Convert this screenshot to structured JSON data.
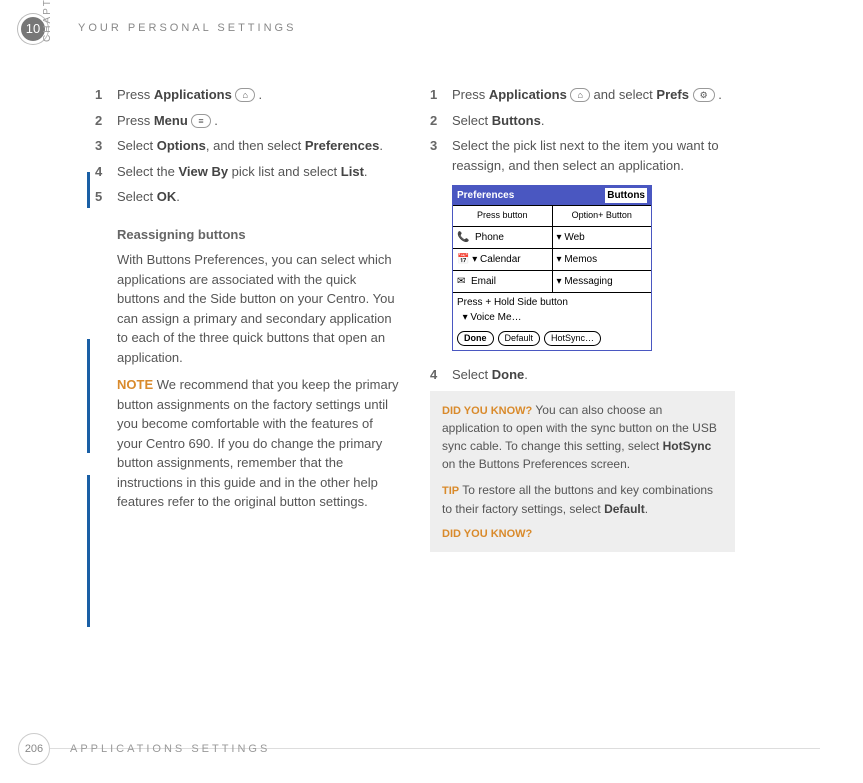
{
  "header": {
    "chapter_number": "10",
    "chapter_label": "CHAPTER",
    "title": "YOUR PERSONAL SETTINGS"
  },
  "footer": {
    "page_number": "206",
    "section": "APPLICATIONS SETTINGS"
  },
  "icons": {
    "home": "⌂",
    "menu": "≡",
    "prefs": "⚙"
  },
  "left": {
    "steps": [
      {
        "n": "1",
        "pre": "Press ",
        "bold": "Applications",
        "post": " ",
        "icon": "home",
        "tail": " ."
      },
      {
        "n": "2",
        "pre": "Press ",
        "bold": "Menu",
        "post": " ",
        "icon": "menu",
        "tail": " ."
      },
      {
        "n": "3",
        "pre": "Select ",
        "bold": "Options",
        "post": ", and then select ",
        "bold2": "Preferences",
        "tail2": "."
      },
      {
        "n": "4",
        "pre": "Select the ",
        "bold": "View By",
        "post": " pick list and select ",
        "bold2": "List",
        "tail2": "."
      },
      {
        "n": "5",
        "pre": "Select ",
        "bold": "OK",
        "post": "."
      }
    ],
    "subhead": "Reassigning buttons",
    "para1": "With Buttons Preferences, you can select which applications are associated with the quick buttons and the Side button on your Centro. You can assign a primary and secondary application to each of the three quick buttons that open an application.",
    "note_label": "NOTE",
    "note_body": " We recommend that you keep the primary button assignments on the factory settings until you become comfortable with the features of your Centro 690. If you do change the primary button assignments, remember that the instructions in this guide and in the other help features refer to the original button settings."
  },
  "right": {
    "steps1": [
      {
        "n": "1",
        "pre": "Press ",
        "bold": "Applications",
        "post": " ",
        "icon": "home",
        "mid": " and select ",
        "bold2": "Prefs",
        "post2": " ",
        "icon2": "prefs",
        "tail": " ."
      },
      {
        "n": "2",
        "pre": "Select ",
        "bold": "Buttons",
        "post": "."
      },
      {
        "n": "3",
        "text": "Select the pick list next to the item you want to reassign, and then select an application."
      }
    ],
    "screenshot": {
      "title_left": "Preferences",
      "title_right": "Buttons",
      "head_left": "Press button",
      "head_right": "Option+ Button",
      "rows": [
        {
          "l": "Phone",
          "r": "Web",
          "li": "📞",
          "rd": "▾"
        },
        {
          "l": "Calendar",
          "r": "Memos",
          "li": "📅",
          "ld": "▾",
          "rd": "▾"
        },
        {
          "l": "Email",
          "r": "Messaging",
          "li": "✉",
          "rd": "▾"
        }
      ],
      "side_label": "Press + Hold Side button",
      "side_value": "Voice Me…",
      "side_drop": "▾",
      "buttons": [
        "Done",
        "Default",
        "HotSync…"
      ]
    },
    "step4": {
      "n": "4",
      "pre": "Select ",
      "bold": "Done",
      "post": "."
    },
    "tip1_label": "DID YOU KNOW?",
    "tip1_body": " You can also choose an application to open with the sync button on the USB sync cable. To change this setting, select ",
    "tip1_bold": "HotSync",
    "tip1_tail": " on the Buttons Preferences screen.",
    "tip2_label": "TIP",
    "tip2_body": " To restore all the buttons and key combinations to their factory settings, select ",
    "tip2_bold": "Default",
    "tip2_tail": ".",
    "tip3_label": "DID YOU KNOW?"
  }
}
